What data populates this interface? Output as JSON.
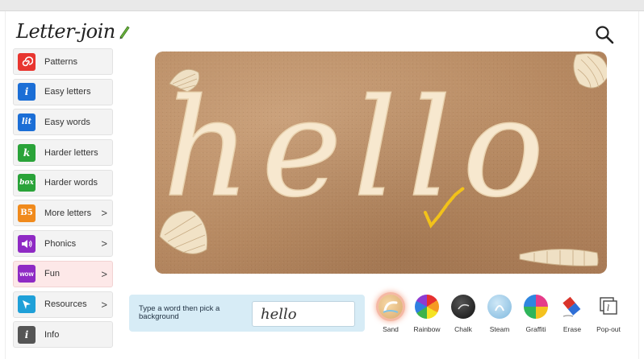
{
  "app": {
    "logo_text": "Letter-join"
  },
  "sidebar": {
    "items": [
      {
        "label": "Patterns",
        "icon": "spiral-icon",
        "color": "#e8352f",
        "glyph": "◎",
        "chevron": false,
        "active": false
      },
      {
        "label": "Easy letters",
        "icon": "easy-letters-icon",
        "color": "#1b6ed6",
        "glyph": "i",
        "chevron": false,
        "active": false
      },
      {
        "label": "Easy words",
        "icon": "easy-words-icon",
        "color": "#1b6ed6",
        "glyph": "lit",
        "chevron": false,
        "active": false
      },
      {
        "label": "Harder letters",
        "icon": "harder-letters-icon",
        "color": "#2aa339",
        "glyph": "k",
        "chevron": false,
        "active": false
      },
      {
        "label": "Harder words",
        "icon": "harder-words-icon",
        "color": "#2aa339",
        "glyph": "box",
        "chevron": false,
        "active": false
      },
      {
        "label": "More letters",
        "icon": "more-letters-icon",
        "color": "#f08a1c",
        "glyph": "B5",
        "chevron": true,
        "active": false
      },
      {
        "label": "Phonics",
        "icon": "speaker-icon",
        "color": "#8f2ac4",
        "glyph": "◀)",
        "chevron": true,
        "active": false
      },
      {
        "label": "Fun",
        "icon": "wow-icon",
        "color": "#8f2ac4",
        "glyph": "wow",
        "chevron": true,
        "active": true
      },
      {
        "label": "Resources",
        "icon": "cursor-arrow-icon",
        "color": "#1fa0d8",
        "glyph": "➤",
        "chevron": true,
        "active": false
      },
      {
        "label": "Info",
        "icon": "info-icon",
        "color": "#555555",
        "glyph": "i",
        "chevron": false,
        "active": false
      }
    ],
    "chevron_glyph": ">"
  },
  "canvas": {
    "word": "hello",
    "background": "Sand"
  },
  "bottom": {
    "label": "Type a word then pick a background",
    "input_value": "hello"
  },
  "backgrounds": [
    {
      "label": "Sand",
      "icon": "sand-icon",
      "selected": true
    },
    {
      "label": "Rainbow",
      "icon": "rainbow-icon",
      "selected": false
    },
    {
      "label": "Chalk",
      "icon": "chalk-icon",
      "selected": false
    },
    {
      "label": "Steam",
      "icon": "steam-icon",
      "selected": false
    },
    {
      "label": "Graffiti",
      "icon": "graffiti-icon",
      "selected": false
    },
    {
      "label": "Erase",
      "icon": "eraser-icon",
      "selected": false
    },
    {
      "label": "Pop-out",
      "icon": "pop-out-icon",
      "selected": false
    }
  ]
}
